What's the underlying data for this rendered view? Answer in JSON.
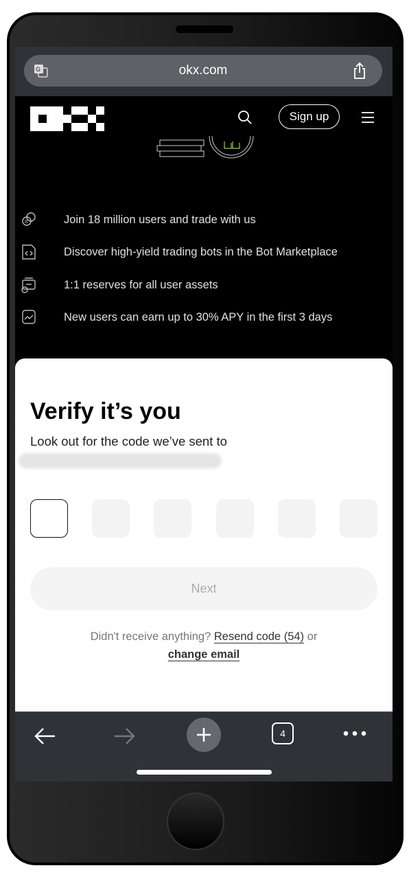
{
  "browser": {
    "url": "okx.com",
    "tab_count": "4"
  },
  "header": {
    "signup_label": "Sign up"
  },
  "features": [
    {
      "icon": "crypto-exchange-icon",
      "text": "Join 18 million users and trade with us"
    },
    {
      "icon": "code-file-icon",
      "text": "Discover high-yield trading bots in the Bot Marketplace"
    },
    {
      "icon": "wallet-check-icon",
      "text": "1:1 reserves for all user assets"
    },
    {
      "icon": "chart-star-icon",
      "text": "New users can earn up to 30% APY in the first 3 days"
    }
  ],
  "modal": {
    "title": "Verify it’s you",
    "subtitle": "Look out for the code we’ve sent to",
    "next_label": "Next",
    "resend_prefix": "Didn't receive anything?",
    "resend_link": "Resend code (54)",
    "or": "or",
    "change_email": "change email"
  }
}
